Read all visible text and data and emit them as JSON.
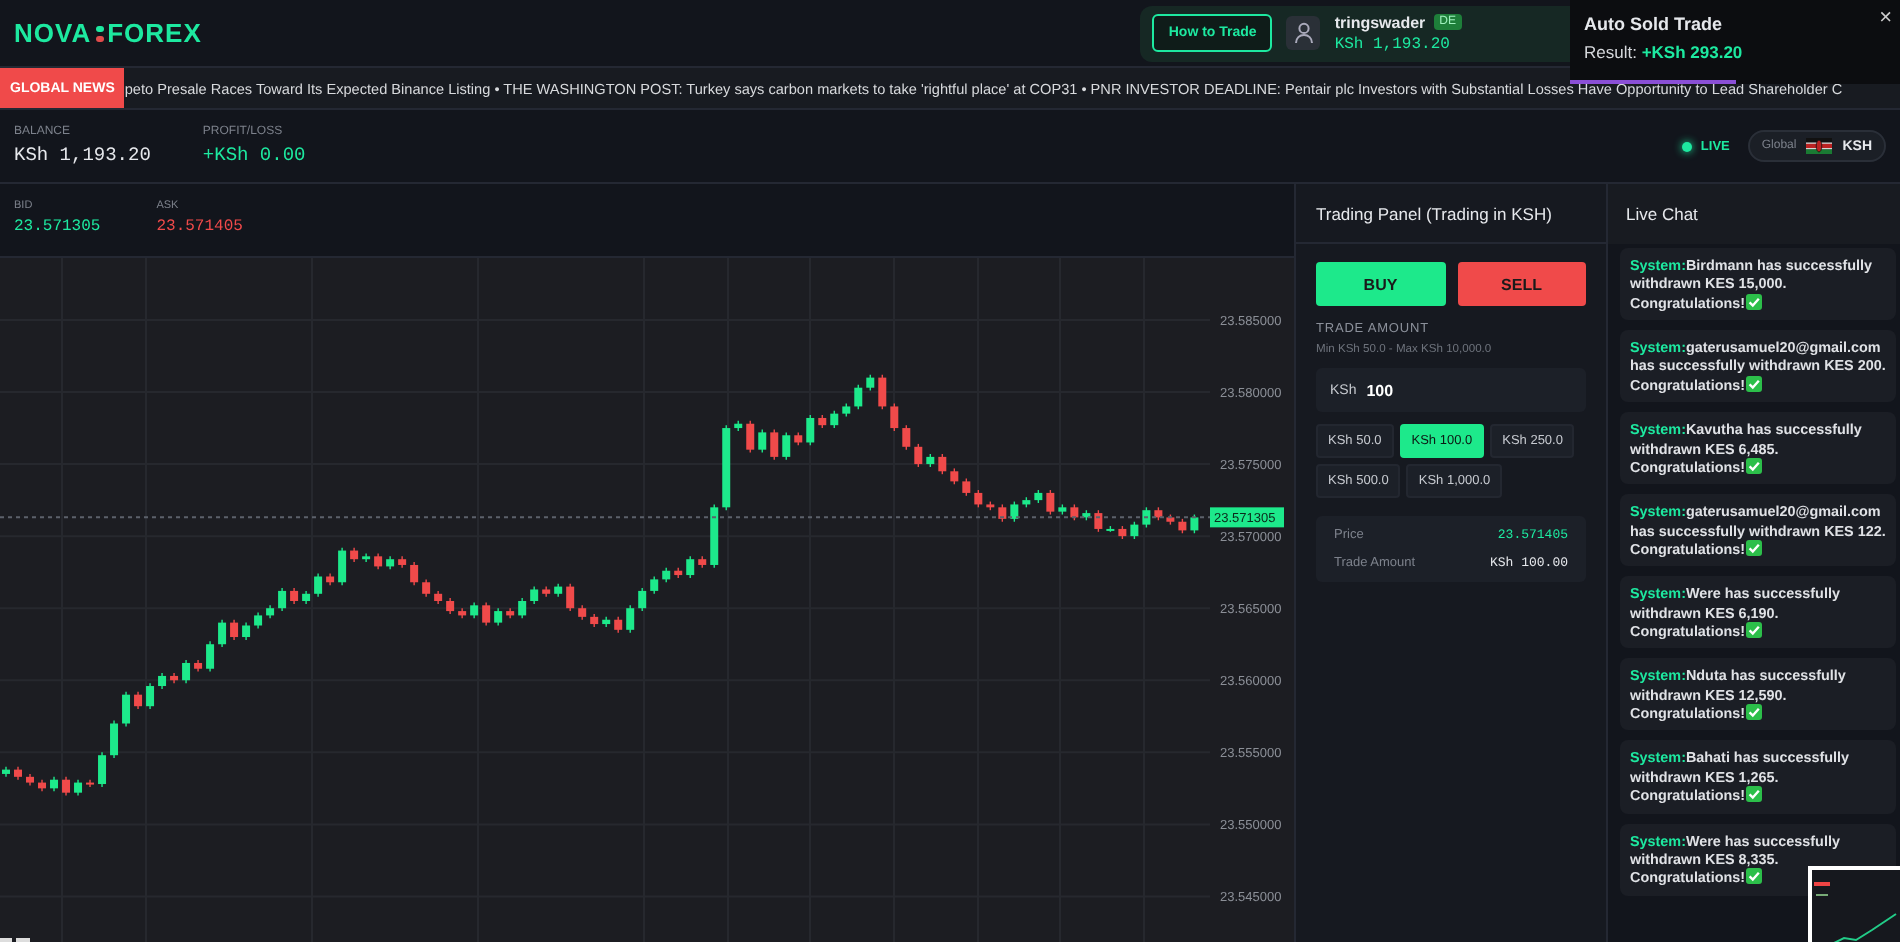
{
  "brand": {
    "left": "NOVA",
    "right": "FOREX"
  },
  "account": {
    "help_button": "How to Trade",
    "username": "tringswader",
    "badge": "DE",
    "balance": "KSh 1,193.20"
  },
  "toast": {
    "title": "Auto Sold Trade",
    "result_label": "Result: ",
    "result_value": "+KSh 293.20",
    "close": "×",
    "level": 0.5
  },
  "news": {
    "label": "GLOBAL NEWS",
    "text": "peto Presale Races Toward Its Expected Binance Listing • THE WASHINGTON POST: Turkey says carbon markets to take 'rightful place' at COP31 • PNR INVESTOR DEADLINE: Pentair plc Investors with Substantial Losses Have Opportunity to Lead Shareholder C"
  },
  "stats": [
    {
      "label": "BALANCE",
      "value": "KSh 1,193.20",
      "kind": "neutral"
    },
    {
      "label": "PROFIT/LOSS",
      "value": "+KSh 0.00",
      "kind": "positive"
    }
  ],
  "live": {
    "label": "LIVE",
    "on": true
  },
  "market": {
    "scope": "Global",
    "currency": "KSH"
  },
  "quotes": [
    {
      "label": "BID",
      "value": "23.571305",
      "kind": "bid"
    },
    {
      "label": "ASK",
      "value": "23.571405",
      "kind": "ask"
    }
  ],
  "price_chart": {
    "chart_data": {
      "type": "candlestick",
      "ylim": [
        23.5417,
        23.5893
      ],
      "grid": true,
      "ref_lines": [
        {
          "axis": "y",
          "value": 23.571305,
          "label": "23.571305"
        }
      ],
      "yticks": [
        {
          "value": 23.585,
          "label": "23.585000"
        },
        {
          "value": 23.58,
          "label": "23.580000"
        },
        {
          "value": 23.575,
          "label": "23.575000"
        },
        {
          "value": 23.57,
          "label": "23.570000"
        },
        {
          "value": 23.565,
          "label": "23.565000"
        },
        {
          "value": 23.56,
          "label": "23.560000"
        },
        {
          "value": 23.555,
          "label": "23.555000"
        },
        {
          "value": 23.55,
          "label": "23.550000"
        },
        {
          "value": 23.545,
          "label": "23.545000"
        }
      ],
      "categories": [
        null,
        null,
        null,
        null,
        null,
        null,
        null,
        null,
        null,
        null,
        null,
        null,
        null,
        null,
        null,
        null,
        null,
        null,
        null,
        null,
        null,
        null,
        null,
        null,
        null,
        null,
        null,
        null,
        null,
        null,
        null,
        null,
        null,
        null,
        null,
        null,
        null,
        null,
        null,
        null,
        null,
        null,
        null,
        null,
        null,
        null,
        null,
        null,
        null,
        null,
        null,
        null,
        null,
        null,
        null,
        null,
        null,
        null,
        null,
        null,
        null,
        null,
        null,
        null,
        null,
        null,
        null,
        null,
        null,
        null,
        null,
        null,
        null,
        null,
        null,
        null,
        null,
        null,
        null,
        null,
        null,
        null,
        null,
        null,
        null,
        null,
        null,
        null,
        null,
        null,
        null,
        null,
        null,
        null,
        null,
        null,
        null,
        null,
        null,
        null
      ],
      "ohlc": [
        [
          23.5535,
          23.554,
          23.5533,
          23.5538
        ],
        [
          23.5538,
          23.554,
          23.5531,
          23.5533
        ],
        [
          23.5533,
          23.5535,
          23.5527,
          23.5529
        ],
        [
          23.5529,
          23.5531,
          23.5523,
          23.5525
        ],
        [
          23.5525,
          23.5533,
          23.5523,
          23.5531
        ],
        [
          23.5531,
          23.5533,
          23.552,
          23.5522
        ],
        [
          23.5522,
          23.5531,
          23.552,
          23.5529
        ],
        [
          23.5529,
          23.5531,
          23.5526,
          23.5528
        ],
        [
          23.5528,
          23.555,
          23.5526,
          23.5548
        ],
        [
          23.5548,
          23.5572,
          23.5546,
          23.557
        ],
        [
          23.557,
          23.5592,
          23.5568,
          23.559
        ],
        [
          23.559,
          23.5592,
          23.558,
          23.5582
        ],
        [
          23.5582,
          23.5598,
          23.558,
          23.5596
        ],
        [
          23.5596,
          23.5605,
          23.5594,
          23.5603
        ],
        [
          23.5603,
          23.5605,
          23.5598,
          23.56
        ],
        [
          23.56,
          23.5614,
          23.5598,
          23.5612
        ],
        [
          23.5612,
          23.5614,
          23.5606,
          23.5608
        ],
        [
          23.5608,
          23.5627,
          23.5606,
          23.5625
        ],
        [
          23.5625,
          23.5642,
          23.5623,
          23.564
        ],
        [
          23.564,
          23.5642,
          23.5628,
          23.563
        ],
        [
          23.563,
          23.564,
          23.5628,
          23.5638
        ],
        [
          23.5638,
          23.5647,
          23.5636,
          23.5645
        ],
        [
          23.5645,
          23.5652,
          23.5643,
          23.565
        ],
        [
          23.565,
          23.5664,
          23.5648,
          23.5662
        ],
        [
          23.5662,
          23.5664,
          23.5653,
          23.5655
        ],
        [
          23.5655,
          23.5662,
          23.5653,
          23.566
        ],
        [
          23.566,
          23.5674,
          23.5658,
          23.5672
        ],
        [
          23.5672,
          23.5674,
          23.5666,
          23.5668
        ],
        [
          23.5668,
          23.5692,
          23.5666,
          23.569
        ],
        [
          23.569,
          23.5692,
          23.5682,
          23.5684
        ],
        [
          23.5684,
          23.5688,
          23.5682,
          23.5686
        ],
        [
          23.5686,
          23.5688,
          23.5677,
          23.5679
        ],
        [
          23.5679,
          23.5686,
          23.5677,
          23.5684
        ],
        [
          23.5684,
          23.5686,
          23.5678,
          23.568
        ],
        [
          23.568,
          23.5682,
          23.5666,
          23.5668
        ],
        [
          23.5668,
          23.567,
          23.5658,
          23.566
        ],
        [
          23.566,
          23.5662,
          23.5653,
          23.5655
        ],
        [
          23.5655,
          23.5657,
          23.5646,
          23.5648
        ],
        [
          23.5648,
          23.565,
          23.5643,
          23.5645
        ],
        [
          23.5645,
          23.5654,
          23.5643,
          23.5652
        ],
        [
          23.5652,
          23.5654,
          23.5638,
          23.564
        ],
        [
          23.564,
          23.565,
          23.5638,
          23.5648
        ],
        [
          23.5648,
          23.565,
          23.5643,
          23.5645
        ],
        [
          23.5645,
          23.5657,
          23.5643,
          23.5655
        ],
        [
          23.5655,
          23.5665,
          23.5653,
          23.5663
        ],
        [
          23.5663,
          23.5665,
          23.5658,
          23.566
        ],
        [
          23.566,
          23.5667,
          23.5658,
          23.5665
        ],
        [
          23.5665,
          23.5667,
          23.5648,
          23.565
        ],
        [
          23.565,
          23.5652,
          23.5642,
          23.5644
        ],
        [
          23.5644,
          23.5646,
          23.5637,
          23.5639
        ],
        [
          23.5639,
          23.5644,
          23.5637,
          23.5642
        ],
        [
          23.5642,
          23.5644,
          23.5633,
          23.5635
        ],
        [
          23.5635,
          23.5652,
          23.5633,
          23.565
        ],
        [
          23.565,
          23.5664,
          23.5648,
          23.5662
        ],
        [
          23.5662,
          23.5672,
          23.566,
          23.567
        ],
        [
          23.567,
          23.5678,
          23.5668,
          23.5676
        ],
        [
          23.5676,
          23.5678,
          23.5671,
          23.5673
        ],
        [
          23.5673,
          23.5686,
          23.5671,
          23.5684
        ],
        [
          23.5684,
          23.5686,
          23.5678,
          23.568
        ],
        [
          23.568,
          23.5722,
          23.5678,
          23.572
        ],
        [
          23.572,
          23.5777,
          23.5718,
          23.5775
        ],
        [
          23.5775,
          23.578,
          23.5773,
          23.5778
        ],
        [
          23.5778,
          23.578,
          23.5758,
          23.576
        ],
        [
          23.576,
          23.5774,
          23.5758,
          23.5772
        ],
        [
          23.5772,
          23.5774,
          23.5753,
          23.5755
        ],
        [
          23.5755,
          23.5772,
          23.5753,
          23.577
        ],
        [
          23.577,
          23.5772,
          23.5763,
          23.5765
        ],
        [
          23.5765,
          23.5784,
          23.5763,
          23.5782
        ],
        [
          23.5782,
          23.5784,
          23.5775,
          23.5777
        ],
        [
          23.5777,
          23.5787,
          23.5775,
          23.5785
        ],
        [
          23.5785,
          23.5792,
          23.5783,
          23.579
        ],
        [
          23.579,
          23.5805,
          23.5788,
          23.5803
        ],
        [
          23.5803,
          23.5812,
          23.5801,
          23.581
        ],
        [
          23.581,
          23.5812,
          23.5788,
          23.579
        ],
        [
          23.579,
          23.5792,
          23.5773,
          23.5775
        ],
        [
          23.5775,
          23.5777,
          23.576,
          23.5762
        ],
        [
          23.5762,
          23.5764,
          23.5748,
          23.575
        ],
        [
          23.575,
          23.5757,
          23.5748,
          23.5755
        ],
        [
          23.5755,
          23.5757,
          23.5743,
          23.5745
        ],
        [
          23.5745,
          23.5747,
          23.5736,
          23.5738
        ],
        [
          23.5738,
          23.574,
          23.5728,
          23.573
        ],
        [
          23.573,
          23.5732,
          23.572,
          23.5722
        ],
        [
          23.5722,
          23.5724,
          23.5718,
          23.572
        ],
        [
          23.572,
          23.5722,
          23.571,
          23.5712
        ],
        [
          23.5712,
          23.5724,
          23.571,
          23.5722
        ],
        [
          23.5722,
          23.5727,
          23.572,
          23.5725
        ],
        [
          23.5725,
          23.5732,
          23.5723,
          23.573
        ],
        [
          23.573,
          23.5732,
          23.5715,
          23.5717
        ],
        [
          23.5717,
          23.5722,
          23.5715,
          23.572
        ],
        [
          23.572,
          23.5722,
          23.5711,
          23.5713
        ],
        [
          23.5713,
          23.5718,
          23.5711,
          23.5716
        ],
        [
          23.5716,
          23.5718,
          23.5703,
          23.5705
        ],
        [
          23.5705,
          23.5707,
          23.5703,
          23.5705
        ],
        [
          23.5705,
          23.5707,
          23.5698,
          23.57
        ],
        [
          23.57,
          23.571,
          23.5698,
          23.5708
        ],
        [
          23.5708,
          23.572,
          23.5706,
          23.5718
        ],
        [
          23.5718,
          23.572,
          23.5711,
          23.5713
        ],
        [
          23.5713,
          23.5715,
          23.5708,
          23.571
        ],
        [
          23.571,
          23.5712,
          23.5702,
          23.5704
        ],
        [
          23.5704,
          23.5715,
          23.5702,
          23.5713
        ]
      ]
    }
  },
  "trading_panel": {
    "title": "Trading Panel (Trading in KSH)",
    "actions": [
      {
        "label": "BUY",
        "kind": "buy"
      },
      {
        "label": "SELL",
        "kind": "sell"
      }
    ],
    "amount_label": "TRADE AMOUNT",
    "limits": "Min KSh 50.0 - Max KSh 10,000.0",
    "currency": "KSh",
    "amount": "100",
    "presets": [
      {
        "label": "KSh 50.0",
        "selected": false
      },
      {
        "label": "KSh 100.0",
        "selected": true
      },
      {
        "label": "KSh 250.0",
        "selected": false
      },
      {
        "label": "KSh 500.0",
        "selected": false
      },
      {
        "label": "KSh 1,000.0",
        "selected": false
      }
    ],
    "summary": [
      {
        "label": "Price",
        "value": "23.571405",
        "kind": "price"
      },
      {
        "label": "Trade Amount",
        "value": "KSh 100.00",
        "kind": "amount"
      }
    ]
  },
  "chat": {
    "title": "Live Chat",
    "messages": [
      {
        "sender": "System:",
        "text": "Birdmann has successfully withdrawn KES 15,000. Congratulations!"
      },
      {
        "sender": "System:",
        "text": "gaterusamuel20@gmail.com has successfully withdrawn KES 200. Congratulations!"
      },
      {
        "sender": "System:",
        "text": "Kavutha has successfully withdrawn KES 6,485. Congratulations!"
      },
      {
        "sender": "System:",
        "text": "gaterusamuel20@gmail.com has successfully withdrawn KES 122. Congratulations!"
      },
      {
        "sender": "System:",
        "text": "Were has successfully withdrawn KES 6,190. Congratulations!"
      },
      {
        "sender": "System:",
        "text": "Nduta has successfully withdrawn KES 12,590. Congratulations!"
      },
      {
        "sender": "System:",
        "text": "Bahati has successfully withdrawn KES 1,265. Congratulations!"
      },
      {
        "sender": "System:",
        "text": "Were has successfully withdrawn KES 8,335. Congratulations!"
      }
    ]
  }
}
